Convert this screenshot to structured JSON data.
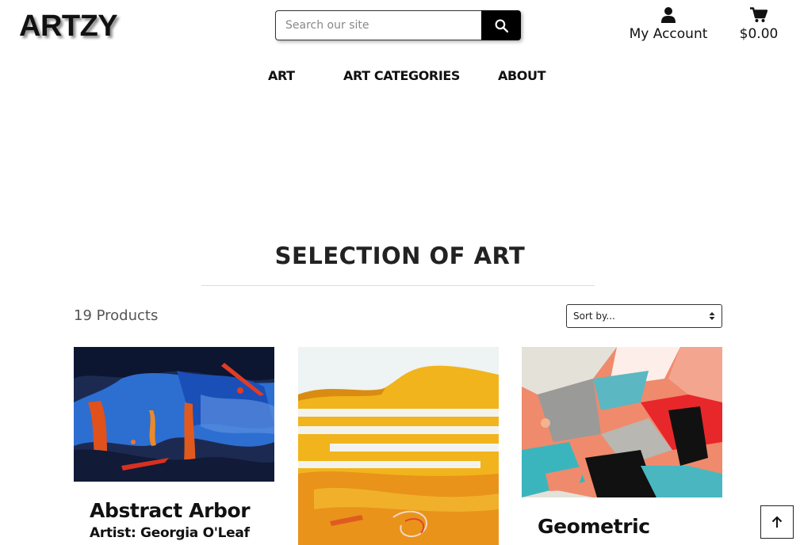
{
  "header": {
    "logo": "ARTZY",
    "search": {
      "placeholder": "Search our site",
      "value": "",
      "button_icon": "search-icon"
    },
    "account": {
      "label": "My Account",
      "icon": "user-icon"
    },
    "cart": {
      "label": "$0.00",
      "icon": "cart-icon"
    }
  },
  "nav": {
    "items": [
      {
        "label": "ART"
      },
      {
        "label": "ART CATEGORIES"
      },
      {
        "label": "ABOUT"
      }
    ]
  },
  "main": {
    "title": "SELECTION OF ART",
    "count": "19 Products",
    "sort": {
      "selected": "Sort by..."
    },
    "products": [
      {
        "title": "Abstract Arbor",
        "artist": "Artist: Georgia O'Leaf"
      },
      {
        "title": "",
        "artist": ""
      },
      {
        "title": "Geometric",
        "artist": ""
      }
    ]
  },
  "back_to_top_icon": "arrow-up-icon",
  "colors": {
    "text": "#111111",
    "button": "#000000",
    "background": "#ffffff"
  }
}
